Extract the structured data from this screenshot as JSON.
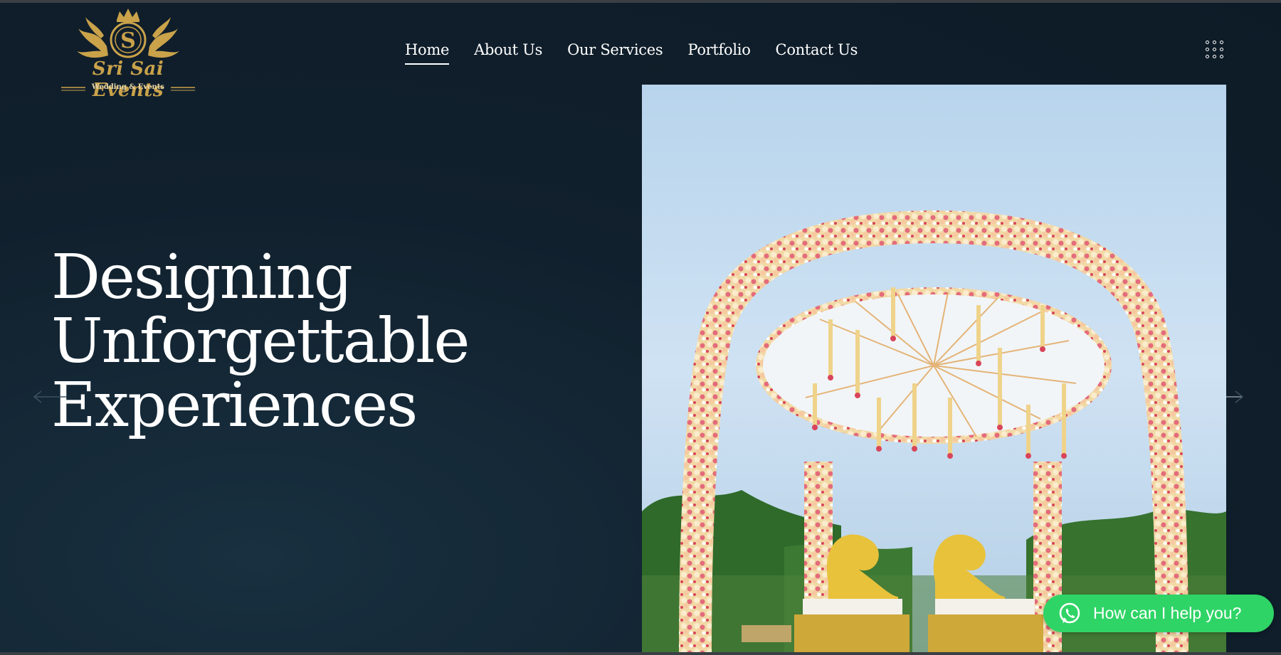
{
  "brand": {
    "monogram": "S",
    "name": "Sri Sai Events",
    "tagline": "Wedding & Events",
    "gold_color": "#c9a24a"
  },
  "nav": {
    "items": [
      {
        "label": "Home",
        "active": true
      },
      {
        "label": "About Us",
        "active": false
      },
      {
        "label": "Our Services",
        "active": false
      },
      {
        "label": "Portfolio",
        "active": false
      },
      {
        "label": "Contact Us",
        "active": false
      }
    ],
    "menu_icon": "grid-dots-icon"
  },
  "hero": {
    "title_lines": [
      "Designing",
      "Unforgettable",
      "Experiences"
    ],
    "prev_icon": "arrow-left-icon",
    "next_icon": "arrow-right-icon",
    "image": "floral-mandap-photo"
  },
  "chat": {
    "label": "How can I help you?",
    "icon": "whatsapp-icon",
    "color": "#2fd466"
  },
  "colors": {
    "background": "#0f1d2a",
    "text": "#ffffff"
  }
}
